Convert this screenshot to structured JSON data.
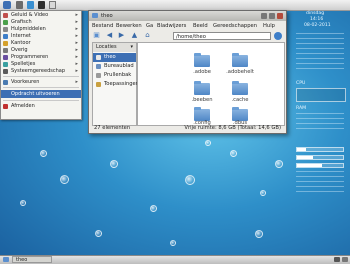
{
  "colors": {
    "accent": "#3d6fb4",
    "desktop": "#2e8fc9"
  },
  "menu": {
    "items": [
      {
        "label": "Geluid & Video",
        "icon": "music-icon",
        "color": "#c0504d",
        "arrow": "▸"
      },
      {
        "label": "Grafisch",
        "icon": "graphics-icon",
        "color": "#4aa04a",
        "arrow": "▸"
      },
      {
        "label": "Hulpmiddelen",
        "icon": "tools-icon",
        "color": "#888888",
        "arrow": "▸"
      },
      {
        "label": "Internet",
        "icon": "globe-icon",
        "color": "#3d7ec8",
        "arrow": "▸"
      },
      {
        "label": "Kantoor",
        "icon": "office-icon",
        "color": "#d4a02a",
        "arrow": "▸"
      },
      {
        "label": "Overig",
        "icon": "misc-icon",
        "color": "#7a7a7a",
        "arrow": "▸"
      },
      {
        "label": "Programmeren",
        "icon": "code-icon",
        "color": "#6a4fa0",
        "arrow": "▸"
      },
      {
        "label": "Spelletjes",
        "icon": "game-icon",
        "color": "#3aa0a0",
        "arrow": "▸"
      },
      {
        "label": "Systeemgereedschap",
        "icon": "system-icon",
        "color": "#5a5a5a",
        "arrow": "▸"
      },
      {
        "label": "Voorkeuren",
        "icon": "preferences-icon",
        "color": "#4a7ab0",
        "arrow": "▸"
      },
      {
        "label": "Opdracht uitvoeren",
        "icon": "",
        "color": "",
        "arrow": ""
      },
      {
        "label": "Afmelden",
        "icon": "logout-icon",
        "color": "#c03030",
        "arrow": ""
      }
    ]
  },
  "filemanager": {
    "title": "theo",
    "menubar": [
      "Bestand",
      "Bewerken",
      "Ga",
      "Bladwijzers",
      "Beeld",
      "Gereedschappen",
      "Hulp"
    ],
    "location": "/home/theo",
    "side_header": "Locaties",
    "places": [
      {
        "label": "theo",
        "icon": "home-icon"
      },
      {
        "label": "Bureaublad",
        "icon": "desktop-icon"
      },
      {
        "label": "Prullenbak",
        "icon": "trash-icon"
      },
      {
        "label": "Toepassingen",
        "icon": "applications-icon"
      }
    ],
    "folders": [
      ".adobe",
      ".adobehelt",
      ".beeben",
      ".cache",
      ".config",
      ".dbus"
    ],
    "status_left": "27 elementen",
    "status_right": "Vrije ruimte: 8,6 GB (Totaal: 14,6 GB)"
  },
  "conky": {
    "lines": [
      "dinsdag",
      "14:16",
      "08-02-2011"
    ],
    "cpu_label": "CPU",
    "ram_label": "RAM",
    "cpu_level": 0.2,
    "ram_level": 0.35,
    "disk_level": 0.55
  },
  "taskbar": {
    "task": "theo"
  }
}
